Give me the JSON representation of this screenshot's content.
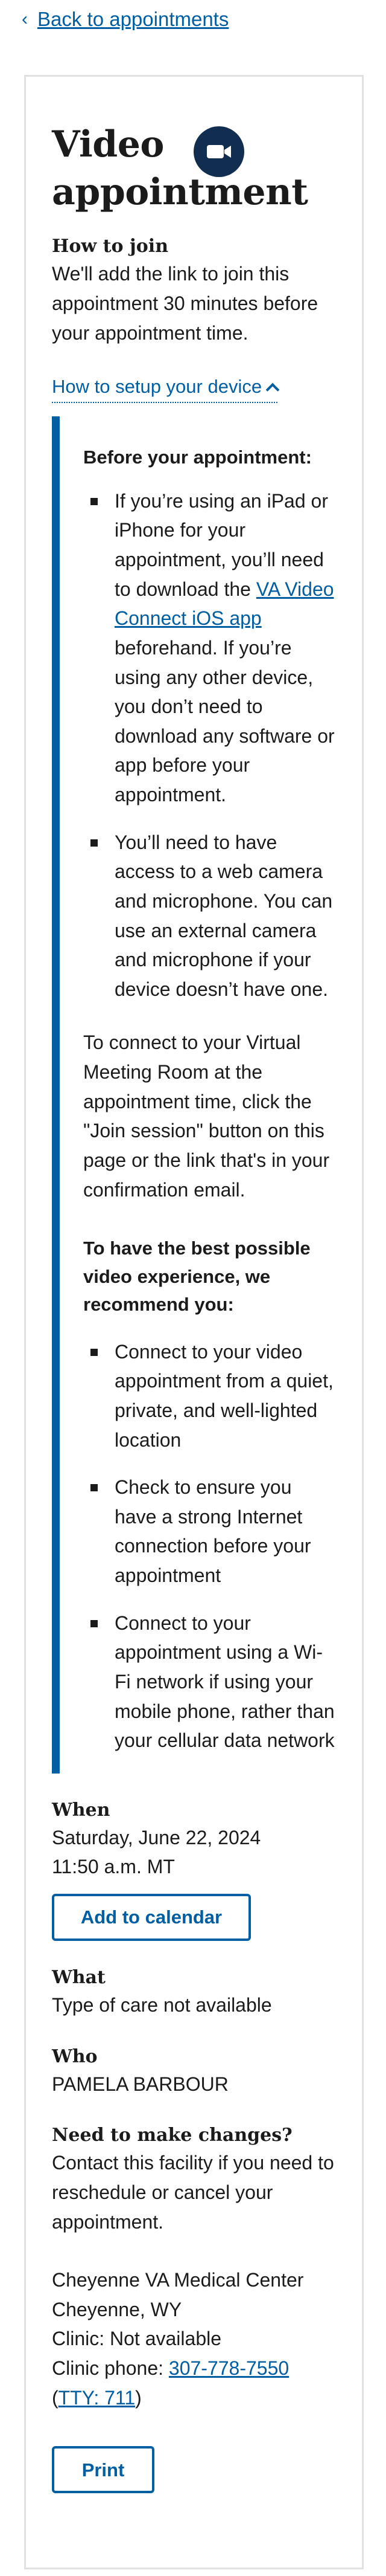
{
  "nav": {
    "back_label": "Back to appointments"
  },
  "page": {
    "title": "Video appointment"
  },
  "how_to_join": {
    "heading": "How to join",
    "body": "We'll add the link to join this appointment 30 minutes before your appointment time."
  },
  "device_toggle": {
    "label": "How to setup your device"
  },
  "before": {
    "heading": "Before your appointment:",
    "item1_pre": "If you’re using an iPad or iPhone for your appointment, you’ll need to download the ",
    "item1_link": "VA Video Connect iOS app",
    "item1_post": " beforehand. If you’re using any other device, you don’t need to download any software or app before your appointment.",
    "item2": "You’ll need to have access to a web camera and microphone. You can use an external camera and microphone if your device doesn’t have one."
  },
  "connect_text": "To connect to your Virtual Meeting Room at the appointment time, click the \"Join session\" button on this page or the link that's in your confirmation email.",
  "recommend": {
    "heading": "To have the best possible video experience, we recommend you:",
    "items": [
      "Connect to your video appointment from a quiet, private, and well-lighted location",
      "Check to ensure you have a strong Internet connection before your appointment",
      "Connect to your appointment using a Wi-Fi network if using your mobile phone, rather than your cellular data network"
    ]
  },
  "when": {
    "heading": "When",
    "date": "Saturday, June 22, 2024",
    "time": "11:50 a.m. MT",
    "calendar_label": "Add to calendar"
  },
  "what": {
    "heading": "What",
    "value": "Type of care not available"
  },
  "who": {
    "heading": "Who",
    "value": "PAMELA BARBOUR"
  },
  "changes": {
    "heading": "Need to make changes?",
    "body": "Contact this facility if you need to reschedule or cancel your appointment."
  },
  "facility": {
    "name": "Cheyenne VA Medical Center",
    "city": "Cheyenne, WY",
    "clinic": "Clinic: Not available",
    "phone_label": "Clinic phone: ",
    "phone": "307-778-7550",
    "tty": "TTY: 711"
  },
  "print_label": "Print",
  "colors": {
    "link": "#005ea2",
    "badge": "#112e51",
    "border": "#dfe1e2"
  },
  "icons": {
    "back": "chevron-left-icon",
    "badge": "video-camera-icon",
    "toggle": "chevron-up-icon"
  }
}
